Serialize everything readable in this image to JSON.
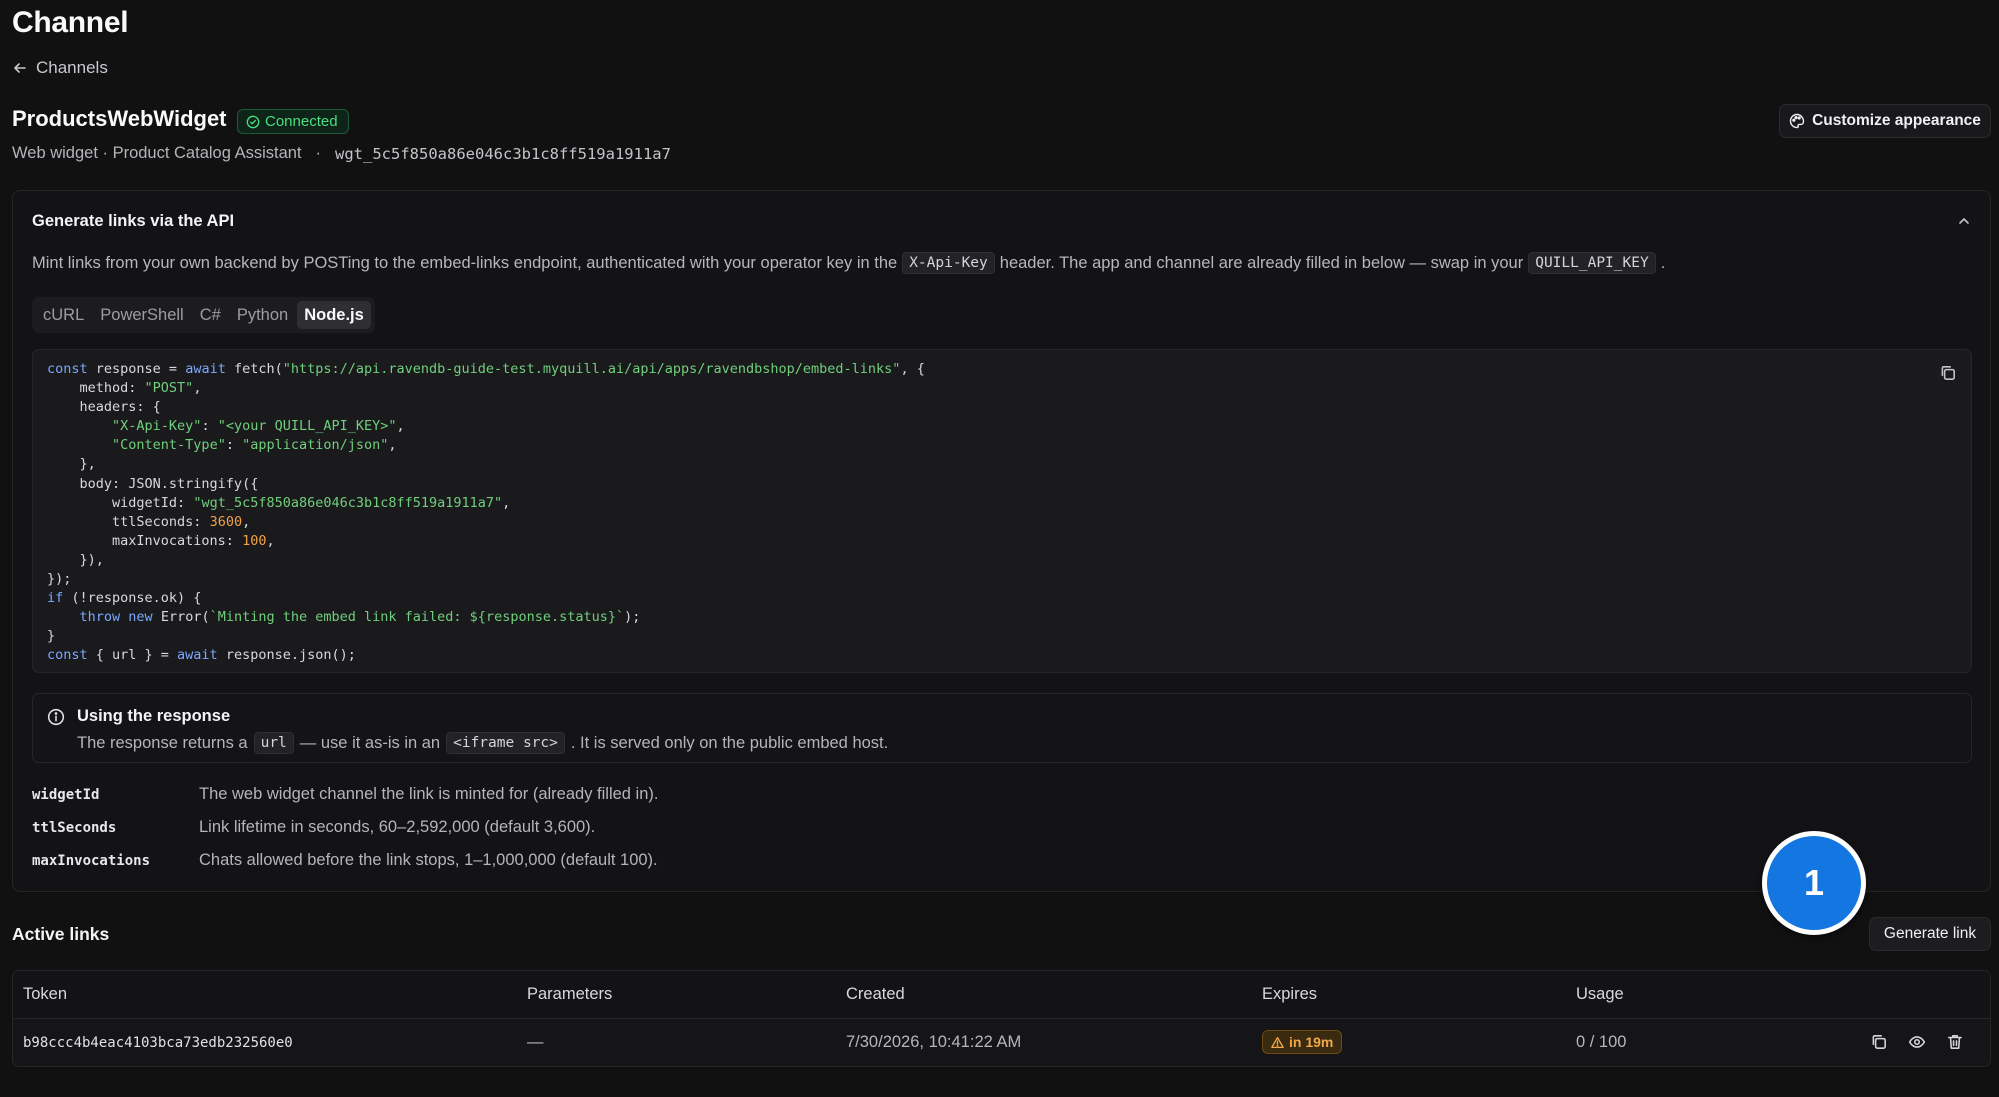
{
  "page": {
    "title": "Channel",
    "back_label": "Channels"
  },
  "channel": {
    "name": "ProductsWebWidget",
    "status": "Connected",
    "meta": "Web widget · Product Catalog Assistant",
    "separator": "·",
    "widget_id": "wgt_5c5f850a86e046c3b1c8ff519a1911a7"
  },
  "actions": {
    "customize": "Customize appearance"
  },
  "api": {
    "title": "Generate links via the API",
    "desc_part1": "Mint links from your own backend by POSTing to the embed-links endpoint, authenticated with your operator key in the",
    "desc_code1": "X-Api-Key",
    "desc_part2": "header. The app and channel are already filled in below — swap in your",
    "desc_code2": "QUILL_API_KEY",
    "desc_part3": ".",
    "tabs": [
      "cURL",
      "PowerShell",
      "C#",
      "Python",
      "Node.js"
    ],
    "active_tab": "Node.js",
    "code_lines": [
      "const response = await fetch(\"https://api.ravendb-guide-test.myquill.ai/api/apps/ravendbshop/embed-links\", {",
      "    method: \"POST\",",
      "    headers: {",
      "        \"X-Api-Key\": \"<your QUILL_API_KEY>\",",
      "        \"Content-Type\": \"application/json\",",
      "    },",
      "    body: JSON.stringify({",
      "        widgetId: \"wgt_5c5f850a86e046c3b1c8ff519a1911a7\",",
      "        ttlSeconds: 3600,",
      "        maxInvocations: 100,",
      "    }),",
      "});",
      "if (!response.ok) {",
      "    throw new Error(`Minting the embed link failed: ${response.status}`);",
      "}",
      "const { url } = await response.json();"
    ]
  },
  "info": {
    "title": "Using the response",
    "text_part1": "The response returns a",
    "text_code1": "url",
    "text_part2": "— use it as-is in an",
    "text_code2": "<iframe src>",
    "text_part3": ". It is served only on the public embed host."
  },
  "params": [
    {
      "name": "widgetId",
      "desc": "The web widget channel the link is minted for (already filled in)."
    },
    {
      "name": "ttlSeconds",
      "desc": "Link lifetime in seconds, 60–2,592,000 (default 3,600)."
    },
    {
      "name": "maxInvocations",
      "desc": "Chats allowed before the link stops, 1–1,000,000 (default 100)."
    }
  ],
  "step_marker": "1",
  "links": {
    "title": "Active links",
    "generate_label": "Generate link",
    "columns": [
      "Token",
      "Parameters",
      "Created",
      "Expires",
      "Usage"
    ],
    "rows": [
      {
        "token": "b98ccc4b4eac4103bca73edb232560e0",
        "parameters": "—",
        "created": "7/30/2026, 10:41:22 AM",
        "expires": "in 19m",
        "usage": "0 / 100"
      }
    ]
  },
  "colors": {
    "background": "#111112",
    "connected": "#4ade80",
    "warning": "#f0a84a",
    "step_marker": "#1476e0"
  },
  "icons": [
    "arrow-left-icon",
    "check-circle-icon",
    "palette-icon",
    "chevron-up-icon",
    "copy-icon",
    "info-icon",
    "warning-icon",
    "eye-icon",
    "trash-icon"
  ]
}
